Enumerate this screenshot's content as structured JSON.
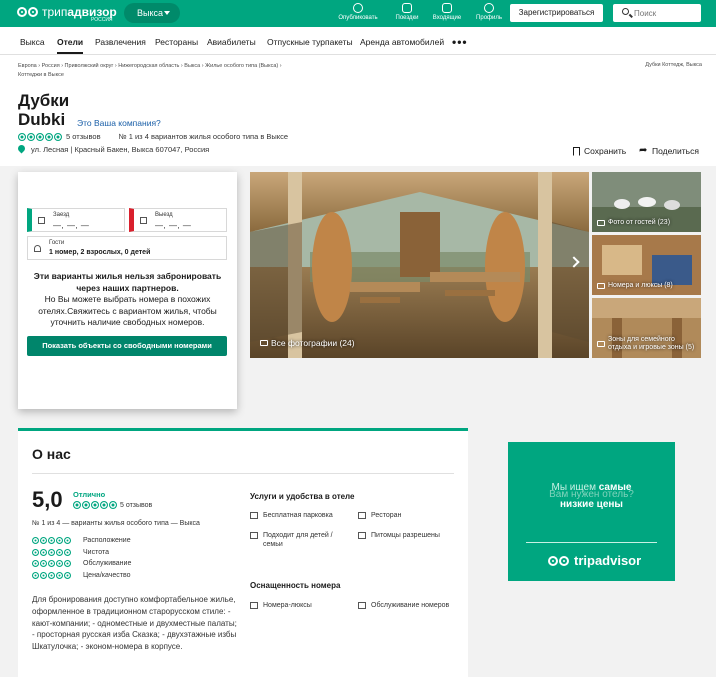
{
  "topbar": {
    "logo_text_light": "трип",
    "logo_text_bold": "адвизор",
    "logo_sub": "РОССИЯ",
    "geo": "Выкса",
    "nav": [
      "Опубликовать",
      "Поездки",
      "Входящие",
      "Профиль"
    ],
    "register": "Зарегистрироваться",
    "search_placeholder": "Поиск"
  },
  "subnav": [
    "Выкса",
    "Отели",
    "Развлечения",
    "Рестораны",
    "Авиабилеты",
    "Отпускные турпакеты",
    "Аренда автомобилей"
  ],
  "breadcrumbs": {
    "line1": "Европа  ›  Россия  ›  Приволжский округ  ›  Нижегородская область  ›  Выкса  ›  Жилье особого типа (Выкса)  ›",
    "line2": "Коттеджи в Выксе",
    "right": "Дубки Коттедж, Выкса"
  },
  "listing": {
    "title_ru": "Дубки",
    "title_en": "Dubki",
    "claim": "Это Ваша компания?",
    "reviews": "5 отзывов",
    "rank": "№ 1 из 4 вариантов жилья особого типа в Выксе",
    "address": "ул. Лесная | Красный Бакен, Выкса 607047, Россия",
    "save": "Сохранить",
    "share": "Поделиться"
  },
  "booking": {
    "checkin_label": "Заезд",
    "checkin_value": "—, —, —",
    "checkout_label": "Выезд",
    "checkout_value": "—, —, —",
    "guests_label": "Гости",
    "guests_value": "1 номер, 2 взрослых, 0 детей",
    "notice_bold": "Эти варианты жилья нельзя забронировать через наших партнеров.",
    "notice_text": "Но Вы можете выбрать номера в похожих отелях.Свяжитесь с вариантом жилья, чтобы уточнить наличие свободных номеров.",
    "button": "Показать объекты со свободными номерами"
  },
  "photos": {
    "main_caption": "Все фотографии (24)",
    "side": [
      "Фото от гостей (23)",
      "Номера и люксы (8)",
      "Зоны для семейного отдыха и игровые зоны (5)"
    ]
  },
  "about": {
    "heading": "О нас",
    "score": "5,0",
    "score_label": "Отлично",
    "reviews": "5 отзывов",
    "rank": "№ 1 из 4 — варианты жилья особого типа — Выкса",
    "sub_ratings": [
      "Расположение",
      "Чистота",
      "Обслуживание",
      "Цена/качество"
    ],
    "description": "Для бронирования доступно комфортабельное жилье, оформленное в традиционном старорусском стиле: - кают-компании; - одноместные и двухместные палаты; - просторная русская изба Сказка; - двухэтажные избы Шкатулочка; - эконом-номера в корпусе.",
    "amenities_heading": "Услуги и удобства в отеле",
    "amenities": [
      "Бесплатная парковка",
      "Ресторан",
      "Подходит для детей / семьи",
      "Питомцы разрешены"
    ],
    "room_heading": "Оснащенность номера",
    "room_features": [
      "Номера-люксы",
      "Обслуживание номеров"
    ]
  },
  "ad": {
    "line1a": "Мы ищем ",
    "line1b": "самые",
    "line1ghost": "Вам нужен отель?",
    "line2": "низкие цены",
    "logo": "tripadvisor"
  },
  "colors": {
    "brand": "#00a680",
    "brand_dark": "#00856b",
    "link": "#1a5fa8",
    "checkout": "#d9202d"
  }
}
